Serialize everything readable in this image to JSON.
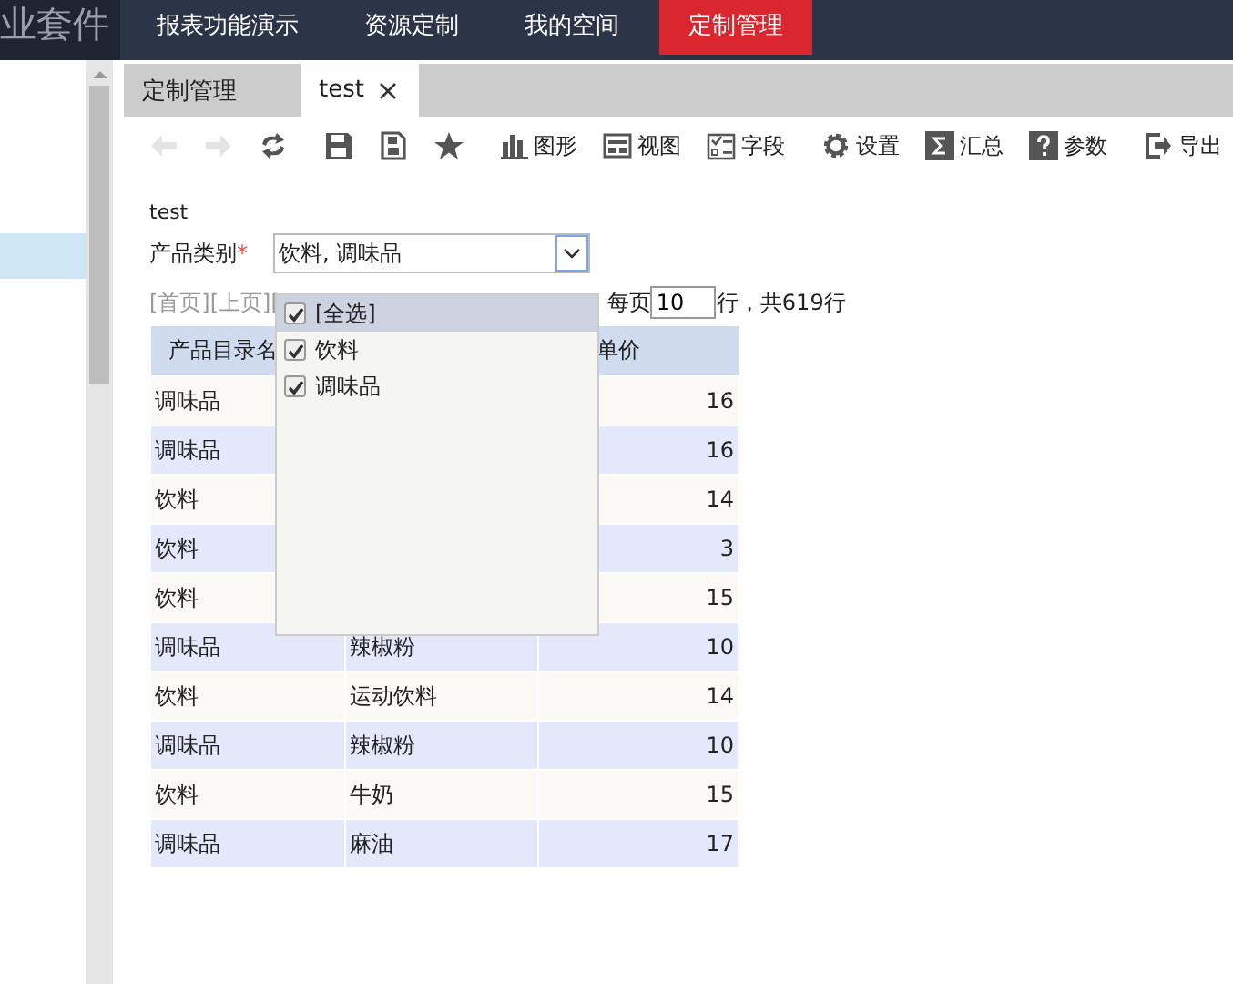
{
  "brand": "业套件",
  "nav": [
    {
      "label": "报表功能演示",
      "selected": false
    },
    {
      "label": "资源定制",
      "selected": false
    },
    {
      "label": "我的空间",
      "selected": false
    },
    {
      "label": "定制管理",
      "selected": true
    }
  ],
  "sidebar": {
    "items": [
      {
        "selected": true
      }
    ]
  },
  "tabs": [
    {
      "label": "定制管理",
      "selected": false,
      "closable": false
    },
    {
      "label": "test",
      "selected": true,
      "closable": true
    }
  ],
  "toolbar": [
    {
      "kind": "back",
      "disabled": true
    },
    {
      "kind": "forward",
      "disabled": true
    },
    {
      "kind": "refresh",
      "disabled": false
    },
    {
      "kind": "sep"
    },
    {
      "kind": "save",
      "disabled": false
    },
    {
      "kind": "saveas",
      "disabled": false
    },
    {
      "kind": "star",
      "disabled": false
    },
    {
      "kind": "sep"
    },
    {
      "kind": "chart",
      "label": "图形"
    },
    {
      "kind": "view",
      "label": "视图"
    },
    {
      "kind": "field",
      "label": "字段"
    },
    {
      "kind": "sep"
    },
    {
      "kind": "gear",
      "label": "设置"
    },
    {
      "kind": "sigma",
      "label": "汇总"
    },
    {
      "kind": "help",
      "label": "参数"
    },
    {
      "kind": "sep"
    },
    {
      "kind": "export",
      "label": "导出"
    }
  ],
  "report": {
    "title": "test",
    "filter": {
      "label": "产品类别",
      "required_mark": "*",
      "value": "饮料, 调味品",
      "expanded": true,
      "options": [
        {
          "label": "[全选]",
          "checked": true,
          "selected": true
        },
        {
          "label": "饮料",
          "checked": true,
          "selected": false
        },
        {
          "label": "调味品",
          "checked": true,
          "selected": false
        }
      ]
    },
    "pager": {
      "links": "[首页][上页][",
      "per_page_label": "每页",
      "per_page": "10",
      "total": "行，共619行"
    },
    "table": {
      "columns": [
        "产品目录名",
        null,
        "单价"
      ],
      "rows": [
        [
          "调味品",
          null,
          "16"
        ],
        [
          "调味品",
          null,
          "16"
        ],
        [
          "饮料",
          null,
          "14"
        ],
        [
          "饮料",
          null,
          "3"
        ],
        [
          "饮料",
          null,
          "15"
        ],
        [
          "调味品",
          "辣椒粉",
          "10"
        ],
        [
          "饮料",
          "运动饮料",
          "14"
        ],
        [
          "调味品",
          "辣椒粉",
          "10"
        ],
        [
          "饮料",
          "牛奶",
          "15"
        ],
        [
          "调味品",
          "麻油",
          "17"
        ]
      ]
    }
  }
}
